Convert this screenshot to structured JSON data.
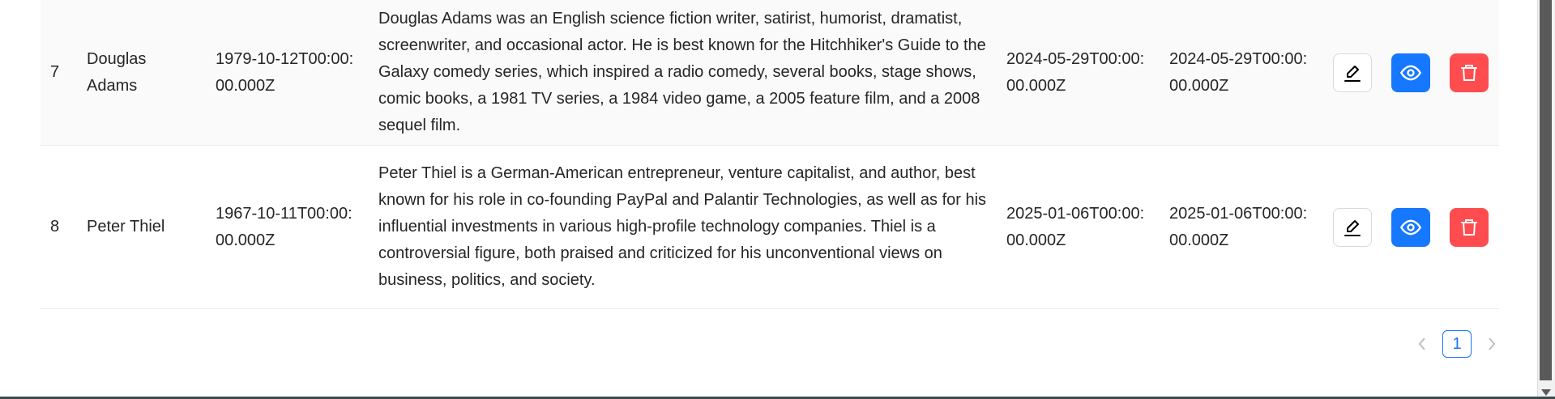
{
  "table": {
    "rows": [
      {
        "id": "7",
        "name": "Douglas Adams",
        "birth_date": "1979-10-12T00:00:00.000Z",
        "bio": "Douglas Adams was an English science fiction writer, satirist, humorist, dramatist, screenwriter, and occasional actor. He is best known for the Hitchhiker's Guide to the Galaxy comedy series, which inspired a radio comedy, several books, stage shows, comic books, a 1981 TV series, a 1984 video game, a 2005 feature film, and a 2008 sequel film.",
        "created_at": "2024-05-29T00:00:00.000Z",
        "updated_at": "2024-05-29T00:00:00.000Z"
      },
      {
        "id": "8",
        "name": "Peter Thiel",
        "birth_date": "1967-10-11T00:00:00.000Z",
        "bio": "Peter Thiel is a German-American entrepreneur, venture capitalist, and author, best known for his role in co-founding PayPal and Palantir Technologies, as well as for his influential investments in various high-profile technology companies. Thiel is a controversial figure, both praised and criticized for his unconventional views on business, politics, and society.",
        "created_at": "2025-01-06T00:00:00.000Z",
        "updated_at": "2025-01-06T00:00:00.000Z"
      }
    ],
    "actions": {
      "edit_icon": "edit-icon",
      "view_icon": "eye-icon",
      "delete_icon": "trash-icon"
    }
  },
  "pagination": {
    "current_page": "1",
    "prev_icon": "chevron-left-icon",
    "next_icon": "chevron-right-icon"
  },
  "colors": {
    "primary": "#1677ff",
    "danger": "#ff4d4f",
    "row_hover": "#fafafa"
  }
}
